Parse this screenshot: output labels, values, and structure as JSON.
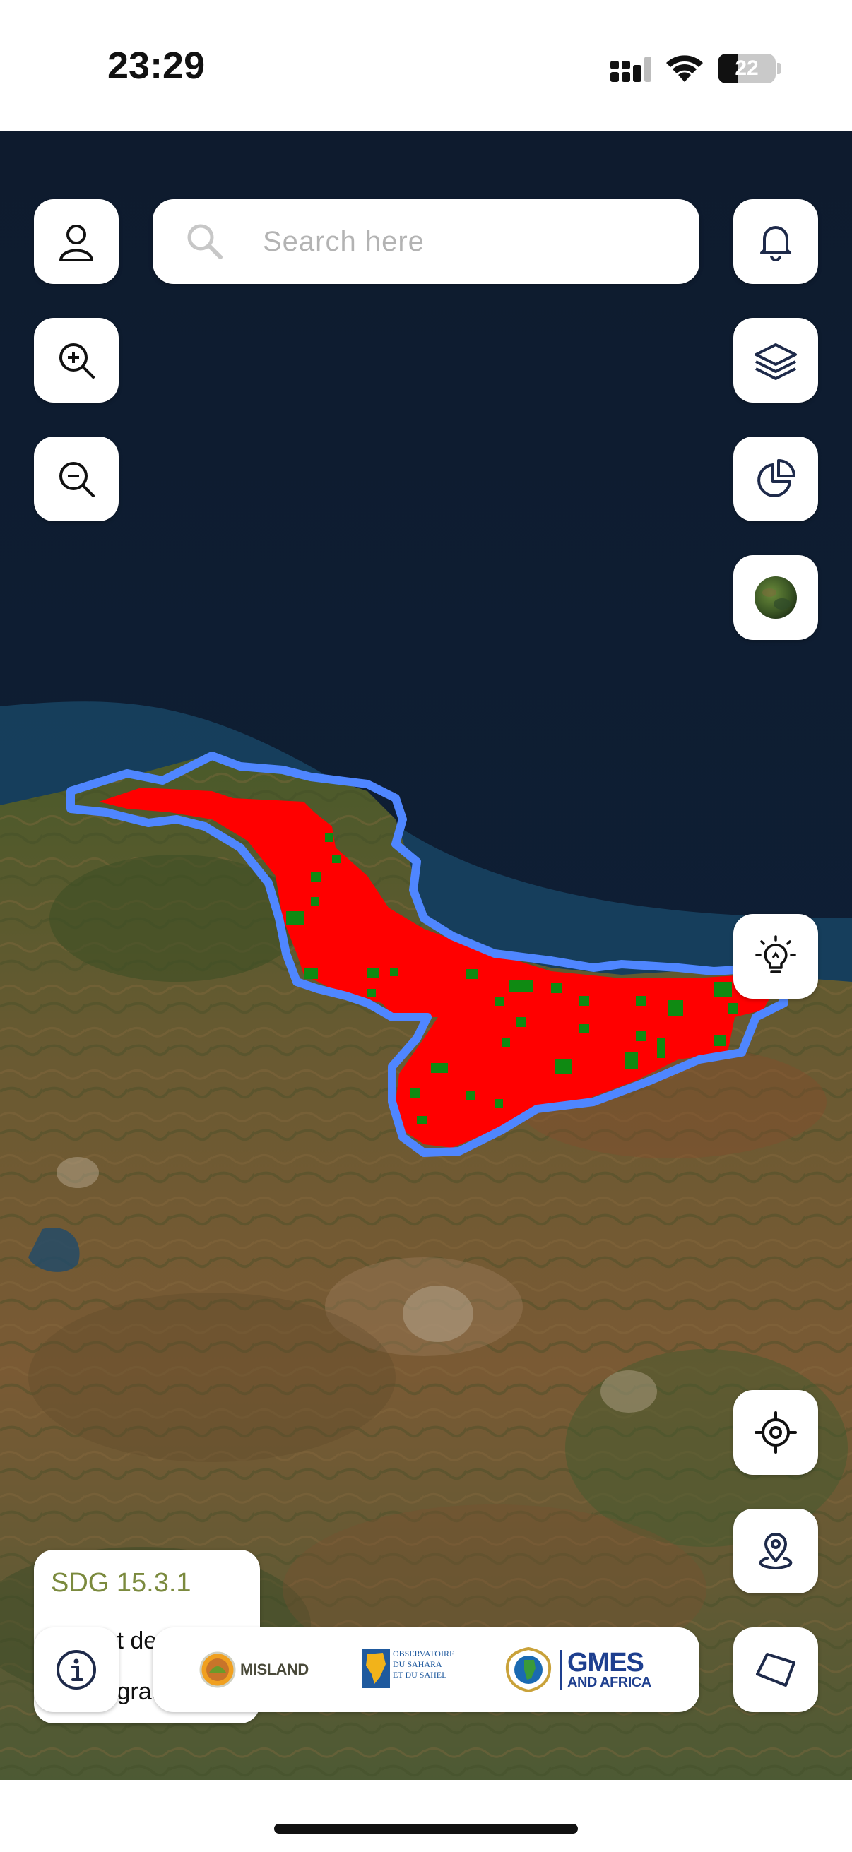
{
  "status_bar": {
    "time": "23:29",
    "battery": "22"
  },
  "search": {
    "placeholder": "Search here"
  },
  "legend": {
    "title": "SDG 15.3.1",
    "items": [
      {
        "label": "Not degraded",
        "color": "#0f8a12"
      },
      {
        "label": "Degraded",
        "color": "#ff0000"
      }
    ]
  },
  "logos": {
    "misland": "MISLAND",
    "oss": [
      "OBSERVATOIRE",
      "DU SAHARA",
      "ET DU SAHEL"
    ],
    "gmes": [
      "GMES",
      "AND AFRICA"
    ]
  },
  "map": {
    "basemap": "satellite",
    "layer": "SDG 15.3.1",
    "boundary_color": "#4f86ff",
    "degraded_color": "#ff0000",
    "not_degraded_color": "#0f8a12"
  },
  "icons": {
    "top_left": [
      "user-icon",
      "zoom-in-icon",
      "zoom-out-icon"
    ],
    "top_right": [
      "bell-icon",
      "layers-icon",
      "pie-chart-icon",
      "basemap-thumbnail"
    ],
    "right": [
      "lightbulb-icon",
      "locate-icon",
      "map-pin-icon",
      "polygon-icon"
    ],
    "bottom_left": [
      "info-icon"
    ]
  }
}
